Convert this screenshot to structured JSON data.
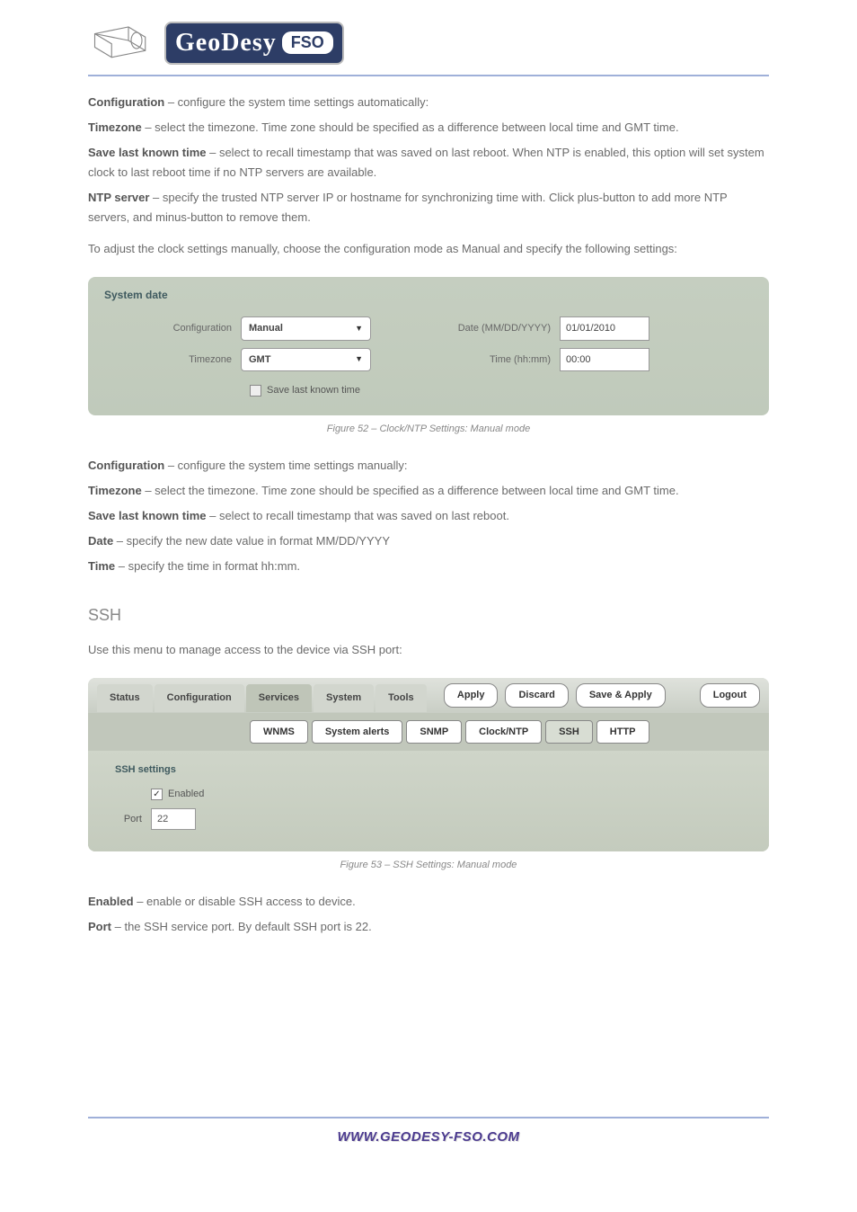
{
  "logo": {
    "brand": "GeoDesy",
    "sub": "FSO"
  },
  "text": {
    "p1_bold": "Configuration",
    "p1_rest": " – configure the system time settings automatically:",
    "p2_bold": "Timezone",
    "p2_rest": " – select the timezone. Time zone should be specified as a difference between local time and GMT time.",
    "p3_bold": "Save last known time",
    "p3_rest": " – select to recall timestamp that was saved on last reboot. When NTP is enabled, this option will set system clock to last reboot time if no NTP servers are available.",
    "p4_bold": "NTP server",
    "p4_rest": " – specify the trusted NTP server IP or hostname for synchronizing time with. Click plus-button to add more NTP servers, and minus-button to remove them.",
    "p5": "To adjust the clock settings manually, choose the configuration mode as Manual and specify the following settings:",
    "p6_bold": "Configuration",
    "p6_rest": " – configure the system time settings manually:",
    "p7_bold": "Timezone",
    "p7_rest": " – select the timezone. Time zone should be specified as a difference between local time and GMT time.",
    "p8_bold": "Save last known time",
    "p8_rest": " – select to recall timestamp that was saved on last reboot.",
    "p9_bold": "Date",
    "p9_rest": " – specify the new date value in format MM/DD/YYYY",
    "p10_bold": "Time",
    "p10_rest": " – specify the time in format hh:mm.",
    "ssh_heading": "SSH",
    "ssh_intro": "Use this menu to manage access to the device via SSH port:",
    "p11_bold": "Enabled",
    "p11_rest": " – enable or disable SSH access to device.",
    "p12_bold": "Port",
    "p12_rest": " – the SSH service port. By default SSH port is 22."
  },
  "system_date": {
    "title": "System date",
    "config_label": "Configuration",
    "config_value": "Manual",
    "tz_label": "Timezone",
    "tz_value": "GMT",
    "save_label": "Save last known time",
    "date_label": "Date (MM/DD/YYYY)",
    "date_value": "01/01/2010",
    "time_label": "Time (hh:mm)",
    "time_value": "00:00"
  },
  "figcap_date": "Figure 52 – Clock/NTP Settings: Manual mode",
  "ssh_panel": {
    "tabs": [
      "Status",
      "Configuration",
      "Services",
      "System",
      "Tools"
    ],
    "buttons": {
      "apply": "Apply",
      "discard": "Discard",
      "saveapply": "Save & Apply",
      "logout": "Logout"
    },
    "subtabs": [
      "WNMS",
      "System alerts",
      "SNMP",
      "Clock/NTP",
      "SSH",
      "HTTP"
    ],
    "settings_title": "SSH settings",
    "enabled_label": "Enabled",
    "port_label": "Port",
    "port_value": "22"
  },
  "figcap_ssh": "Figure 53 – SSH Settings: Manual mode",
  "footer": "WWW.GEODESY-FSO.COM"
}
